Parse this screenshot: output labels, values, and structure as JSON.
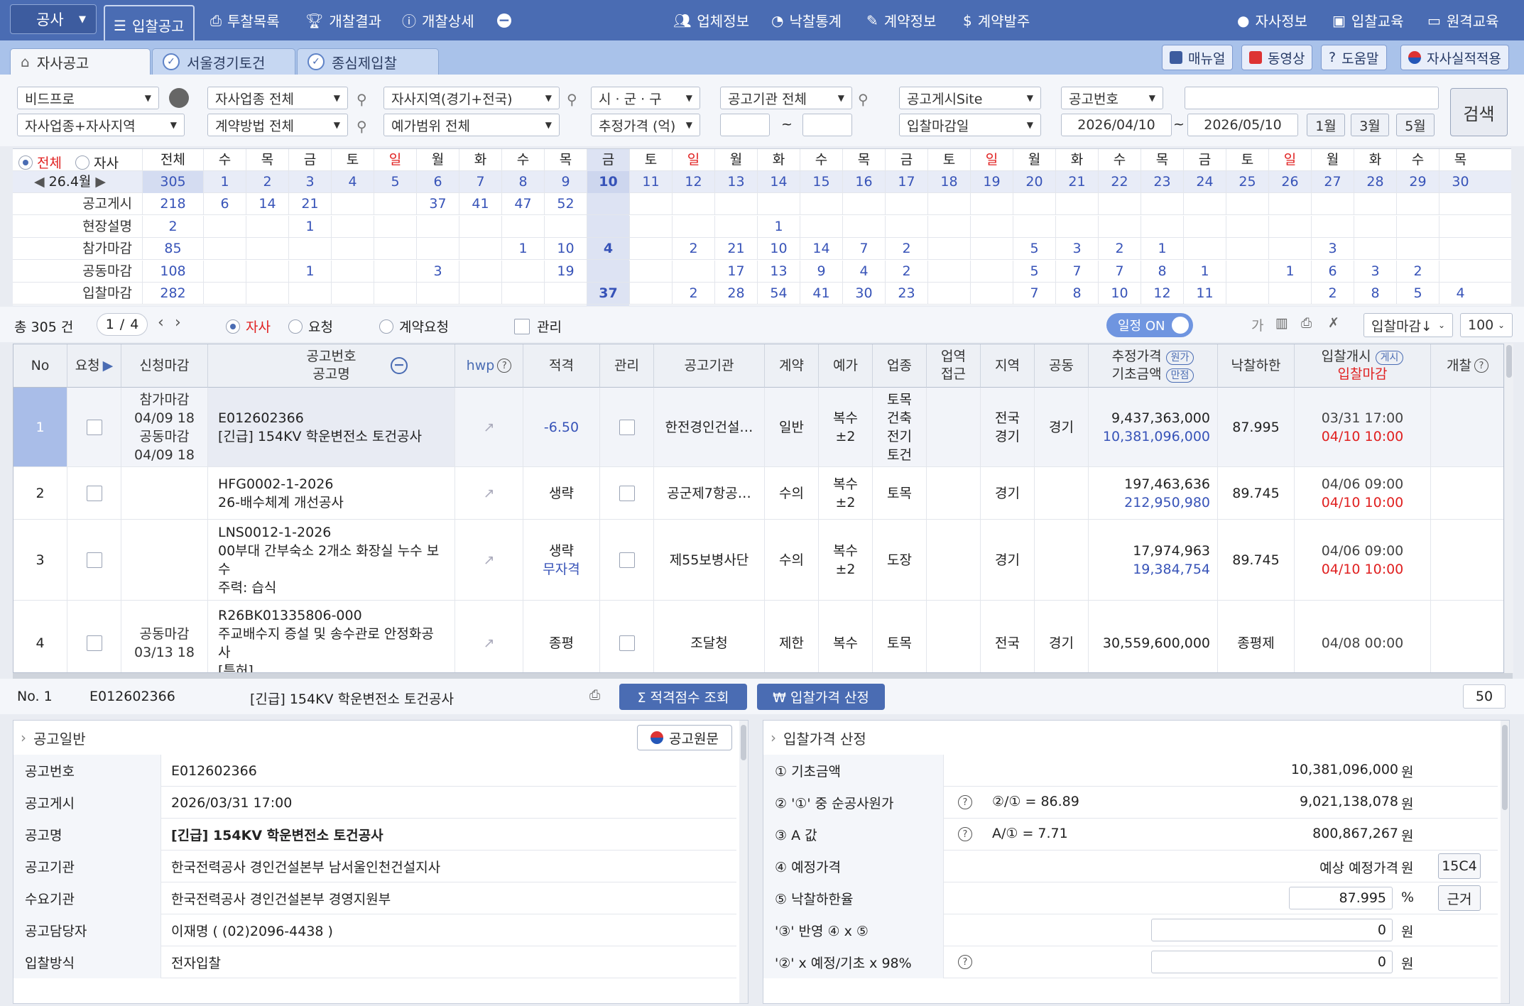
{
  "nav": {
    "category": "공사",
    "items": [
      "입찰공고",
      "투찰목록",
      "개찰결과",
      "개찰상세"
    ],
    "right_items": [
      "업체정보",
      "낙찰통계",
      "계약정보",
      "계약발주"
    ],
    "far_right": [
      "자사정보",
      "입찰교육",
      "원격교육"
    ]
  },
  "tabs": [
    "자사공고",
    "서울경기토건",
    "종심제입찰"
  ],
  "tab_buttons": [
    "매뉴얼",
    "동영상",
    "도움말",
    "자사실적적용"
  ],
  "filters": {
    "row1": [
      "비드프로",
      "자사업종 전체",
      "자사지역(경기+전국)",
      "시 · 군 · 구",
      "공고기관 전체",
      "공고게시Site",
      "공고번호"
    ],
    "row2": [
      "자사업종+자사지역",
      "계약방법 전체",
      "예가범위 전체",
      "추정가격 (억)",
      "입찰마감일"
    ],
    "date_from": "2026/04/10",
    "date_to": "2026/05/10",
    "tilde": "~",
    "months": [
      "1월",
      "3월",
      "5월"
    ],
    "search": "검색"
  },
  "calendar": {
    "radio_all": "전체",
    "radio_own": "자사",
    "total_label": "전체",
    "month": "26.4월",
    "weekdays": [
      "수",
      "목",
      "금",
      "토",
      "일",
      "월",
      "화",
      "수",
      "목",
      "금",
      "토",
      "일",
      "월",
      "화",
      "수",
      "목",
      "금",
      "토",
      "일",
      "월",
      "화",
      "수",
      "목",
      "금",
      "토",
      "일",
      "월",
      "화",
      "수",
      "목"
    ],
    "days": [
      "1",
      "2",
      "3",
      "4",
      "5",
      "6",
      "7",
      "8",
      "9",
      "10",
      "11",
      "12",
      "13",
      "14",
      "15",
      "16",
      "17",
      "18",
      "19",
      "20",
      "21",
      "22",
      "23",
      "24",
      "25",
      "26",
      "27",
      "28",
      "29",
      "30"
    ],
    "total": "305",
    "rows": [
      {
        "label": "공고게시",
        "total": "218",
        "vals": {
          "1": "6",
          "2": "14",
          "3": "21",
          "6": "37",
          "7": "41",
          "8": "47",
          "9": "52"
        }
      },
      {
        "label": "현장설명",
        "total": "2",
        "vals": {
          "3": "1",
          "14": "1"
        }
      },
      {
        "label": "참가마감",
        "total": "85",
        "vals": {
          "8": "1",
          "9": "10",
          "10": "4",
          "12": "2",
          "13": "21",
          "14": "10",
          "15": "14",
          "16": "7",
          "17": "2",
          "20": "5",
          "21": "3",
          "22": "2",
          "23": "1",
          "27": "3"
        }
      },
      {
        "label": "공동마감",
        "total": "108",
        "vals": {
          "3": "1",
          "6": "3",
          "9": "19",
          "13": "17",
          "14": "13",
          "15": "9",
          "16": "4",
          "17": "2",
          "20": "5",
          "21": "7",
          "22": "7",
          "23": "8",
          "24": "1",
          "26": "1",
          "27": "6",
          "28": "3",
          "29": "2"
        }
      },
      {
        "label": "입찰마감",
        "total": "282",
        "vals": {
          "10": "37",
          "12": "2",
          "13": "28",
          "14": "54",
          "15": "41",
          "16": "30",
          "17": "23",
          "20": "7",
          "21": "8",
          "22": "10",
          "23": "12",
          "24": "11",
          "27": "2",
          "28": "8",
          "29": "5",
          "30": "4"
        }
      }
    ]
  },
  "toolbar": {
    "total": "총 305 건",
    "page": "1",
    "pages": "4",
    "slash": "/",
    "opt_own": "자사",
    "opt_req": "요청",
    "opt_contract": "계약요청",
    "opt_manage": "관리",
    "schedule": "일정 ON",
    "font": "가",
    "sort": "입찰마감↓",
    "count": "100"
  },
  "table": {
    "headers": {
      "no": "No",
      "req": "요청",
      "deadline": "신청마감",
      "num": "공고번호",
      "name": "공고명",
      "hwp": "hwp",
      "qual": "적격",
      "manage": "관리",
      "agency": "공고기관",
      "contract": "계약",
      "price_range": "예가",
      "industry": "업종",
      "biz1": "업역",
      "biz2": "접근",
      "region": "지역",
      "joint": "공동",
      "est": "추정가격",
      "base": "기초금액",
      "pill_cost": "원가",
      "pill_full": "만점",
      "low": "낙찰하한",
      "open": "입찰개시",
      "close": "입찰마감",
      "pill_post": "게시",
      "opening": "개찰"
    },
    "rows": [
      {
        "no": "1",
        "deadline": [
          "참가마감",
          "04/09 18",
          "공동마감",
          "04/09 18"
        ],
        "num": "E012602366",
        "name": "[긴급] 154KV 학운변전소 토건공사",
        "qual": "-6.50",
        "qual2": "",
        "agency": "한전경인건설…",
        "contract": "일반",
        "price": [
          "복수",
          "±2"
        ],
        "industry": [
          "토목",
          "건축",
          "전기",
          "토건"
        ],
        "region": [
          "전국",
          "경기"
        ],
        "joint": "경기",
        "est": "9,437,363,000",
        "base": "10,381,096,000",
        "low": "87.995",
        "open": "03/31 17:00",
        "close": "04/10 10:00"
      },
      {
        "no": "2",
        "deadline": [],
        "num": "HFG0002-1-2026",
        "name": "26-배수체계 개선공사",
        "qual": "생략",
        "qual2": "",
        "agency": "공군제7항공…",
        "contract": "수의",
        "price": [
          "복수",
          "±2"
        ],
        "industry": [
          "토목"
        ],
        "region": [
          "경기"
        ],
        "joint": "",
        "est": "197,463,636",
        "base": "212,950,980",
        "low": "89.745",
        "open": "04/06 09:00",
        "close": "04/10 10:00"
      },
      {
        "no": "3",
        "deadline": [],
        "num": "LNS0012-1-2026",
        "name": "00부대 간부숙소 2개소 화장실 누수 보수",
        "name2": "주력: 습식",
        "qual": "생략",
        "qual2": "무자격",
        "agency": "제55보병사단",
        "contract": "수의",
        "price": [
          "복수",
          "±2"
        ],
        "industry": [
          "도장"
        ],
        "region": [
          "경기"
        ],
        "joint": "",
        "est": "17,974,963",
        "base": "19,384,754",
        "low": "89.745",
        "open": "04/06 09:00",
        "close": "04/10 10:00"
      },
      {
        "no": "4",
        "deadline": [
          "공동마감",
          "03/13 18"
        ],
        "num": "R26BK01335806-000",
        "name": "주교배수지 증설 및 송수관로 안정화공사",
        "name2": "[특허]",
        "qual": "종평",
        "qual2": "",
        "agency": "조달청",
        "contract": "제한",
        "price": [
          "복수"
        ],
        "industry": [
          "토목"
        ],
        "region": [
          "전국"
        ],
        "joint": "경기",
        "est": "30,559,600,000",
        "base": "",
        "low": "종평제",
        "open": "04/08 00:00",
        "close": ""
      }
    ]
  },
  "detail_bar": {
    "no": "No. 1",
    "num": "E012602366",
    "name": "[긴급] 154KV 학운변전소 토건공사",
    "btn_score": "Σ 적격점수 조회",
    "btn_price": "₩ 입찰가격 산정",
    "count": "50"
  },
  "general": {
    "title": "공고일반",
    "orig_btn": "공고원문",
    "rows": [
      [
        "공고번호",
        "E012602366"
      ],
      [
        "공고게시",
        "2026/03/31 17:00"
      ],
      [
        "공고명",
        "[긴급] 154KV 학운변전소 토건공사"
      ],
      [
        "공고기관",
        "한국전력공사 경인건설본부 남서울인천건설지사"
      ],
      [
        "수요기관",
        "한국전력공사 경인건설본부 경영지원부"
      ],
      [
        "공고담당자",
        "이재명 ( (02)2096-4438 )"
      ],
      [
        "입찰방식",
        "전자입찰"
      ]
    ]
  },
  "price_calc": {
    "title": "입찰가격 산정",
    "rows": [
      {
        "k": "① 기초금액",
        "mid": "",
        "val": "10,381,096,000",
        "unit": "원"
      },
      {
        "k": "② '①' 중 순공사원가",
        "mid": "②/① = 86.89",
        "val": "9,021,138,078",
        "unit": "원"
      },
      {
        "k": "③ A 값",
        "mid": "A/① = 7.71",
        "val": "800,867,267",
        "unit": "원"
      },
      {
        "k": "④ 예정가격",
        "mid": "",
        "val": "예상 예정가격",
        "unit": "원",
        "btn": "15C4"
      },
      {
        "k": "⑤ 낙찰하한율",
        "mid": "",
        "val": "87.995",
        "unit": "%",
        "btn": "근거"
      },
      {
        "k": "'③' 반영 ④ x ⑤",
        "mid": "",
        "val": "0",
        "unit": "원"
      },
      {
        "k": "'②' x 예정/기초 x 98%",
        "mid": "",
        "val": "0",
        "unit": "원"
      }
    ]
  }
}
